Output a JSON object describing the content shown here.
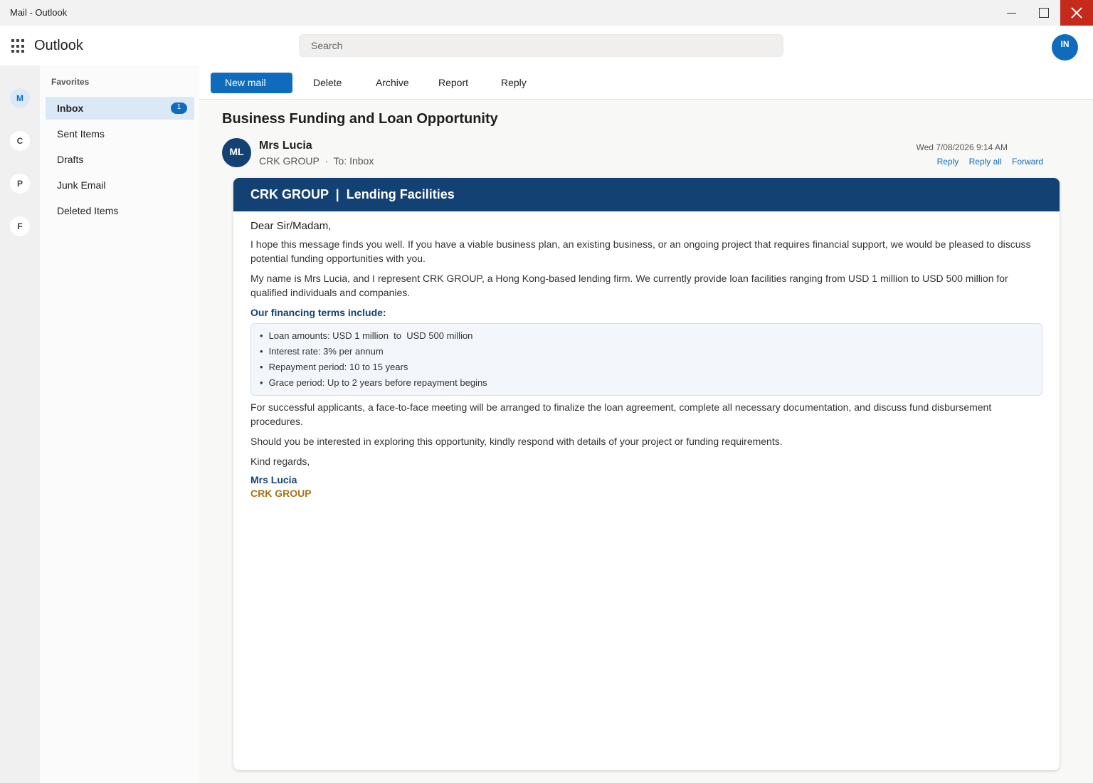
{
  "window": {
    "title": "Mail - Outlook"
  },
  "app": {
    "name": "Outlook"
  },
  "search": {
    "placeholder": "Search"
  },
  "account": {
    "initials": "IN"
  },
  "rail": {
    "items": [
      "M",
      "C",
      "P",
      "F"
    ]
  },
  "folders": {
    "section_label": "Favorites",
    "items": [
      {
        "label": "Inbox",
        "badge": "1"
      },
      {
        "label": "Sent Items"
      },
      {
        "label": "Drafts"
      },
      {
        "label": "Junk Email"
      },
      {
        "label": "Deleted Items"
      }
    ]
  },
  "toolbar": {
    "new_mail": "New mail",
    "delete": "Delete",
    "archive": "Archive",
    "report": "Report",
    "reply": "Reply"
  },
  "message": {
    "subject": "Business Funding and Loan Opportunity",
    "sender_initials": "ML",
    "sender_name": "Mrs Lucia",
    "sender_org": "CRK GROUP",
    "separator": "·",
    "to": "To: Inbox",
    "date": "Wed 7/08/2026 9:14 AM",
    "actions": {
      "reply": "Reply",
      "reply_all": "Reply all",
      "forward": "Forward"
    },
    "banner": "CRK GROUP  |  Lending Facilities",
    "greeting": "Dear Sir/Madam,",
    "para1": "I hope this message finds you well. If you have a viable business plan, an existing business, or an ongoing project that requires financial support, we would be pleased to discuss potential funding opportunities with you.",
    "para2": "My name is Mrs Lucia, and I represent CRK GROUP, a Hong Kong-based lending firm. We currently provide loan facilities ranging from USD 1 million to USD 500 million for qualified individuals and companies.",
    "terms_heading": "Our financing terms include:",
    "terms": [
      "Loan amounts: USD 1 million  to  USD 500 million",
      "Interest rate: 3% per annum",
      "Repayment period: 10 to 15 years",
      "Grace period: Up to 2 years before repayment begins"
    ],
    "para3": "For successful applicants, a face-to-face meeting will be arranged to finalize the loan agreement, complete all necessary documentation, and discuss fund disbursement procedures.",
    "para4": "Should you be interested in exploring this opportunity, kindly respond with details of your project or funding requirements.",
    "closing": "Kind regards,",
    "signature_name": "Mrs Lucia",
    "signature_org": "CRK GROUP"
  }
}
